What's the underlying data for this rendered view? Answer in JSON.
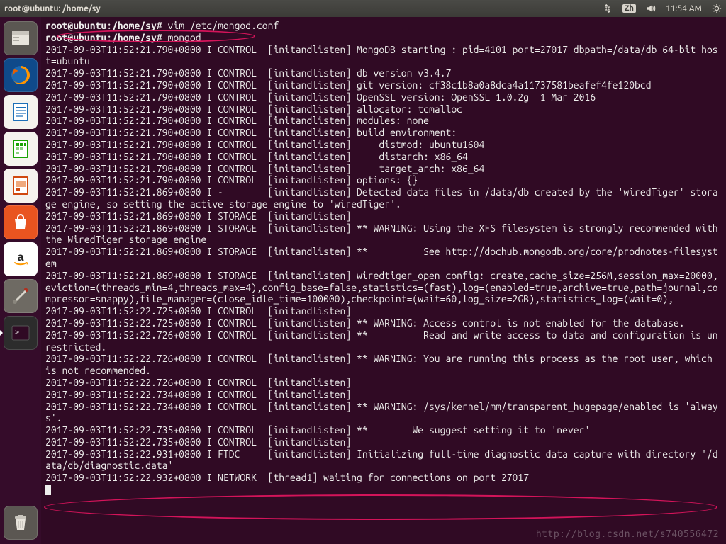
{
  "topbar": {
    "title": "root@ubuntu: /home/sy",
    "ime": "Zh",
    "time": "11:54 AM"
  },
  "launcher": {
    "items": [
      {
        "name": "files-icon",
        "bg": "#5b5752"
      },
      {
        "name": "firefox-icon",
        "bg": "#1b68b0"
      },
      {
        "name": "writer-icon",
        "bg": "#0f6eb6"
      },
      {
        "name": "calc-icon",
        "bg": "#18a303"
      },
      {
        "name": "impress-icon",
        "bg": "#d0480f"
      },
      {
        "name": "software-center-icon",
        "bg": "#e95420"
      },
      {
        "name": "amazon-icon",
        "bg": "#ffffff"
      },
      {
        "name": "settings-icon",
        "bg": "#6e6a63"
      },
      {
        "name": "terminal-icon",
        "bg": "#2c2c2c",
        "active": true
      }
    ],
    "trash": {
      "name": "trash-icon",
      "bg": "#5b5752"
    }
  },
  "terminal": {
    "prompt1_a": "root@ubuntu",
    "prompt1_b": ":",
    "prompt1_c": "/home/sy",
    "prompt1_d": "# ",
    "cmd1": "vim /etc/mongod.conf",
    "cmd2": "mongod",
    "lines": [
      "2017-09-03T11:52:21.790+0800 I CONTROL  [initandlisten] MongoDB starting : pid=4101 port=27017 dbpath=/data/db 64-bit host=ubuntu",
      "2017-09-03T11:52:21.790+0800 I CONTROL  [initandlisten] db version v3.4.7",
      "2017-09-03T11:52:21.790+0800 I CONTROL  [initandlisten] git version: cf38c1b8a0a8dca4a11737581beafef4fe120bcd",
      "2017-09-03T11:52:21.790+0800 I CONTROL  [initandlisten] OpenSSL version: OpenSSL 1.0.2g  1 Mar 2016",
      "2017-09-03T11:52:21.790+0800 I CONTROL  [initandlisten] allocator: tcmalloc",
      "2017-09-03T11:52:21.790+0800 I CONTROL  [initandlisten] modules: none",
      "2017-09-03T11:52:21.790+0800 I CONTROL  [initandlisten] build environment:",
      "2017-09-03T11:52:21.790+0800 I CONTROL  [initandlisten]     distmod: ubuntu1604",
      "2017-09-03T11:52:21.790+0800 I CONTROL  [initandlisten]     distarch: x86_64",
      "2017-09-03T11:52:21.790+0800 I CONTROL  [initandlisten]     target_arch: x86_64",
      "2017-09-03T11:52:21.790+0800 I CONTROL  [initandlisten] options: {}",
      "2017-09-03T11:52:21.869+0800 I -        [initandlisten] Detected data files in /data/db created by the 'wiredTiger' storage engine, so setting the active storage engine to 'wiredTiger'.",
      "2017-09-03T11:52:21.869+0800 I STORAGE  [initandlisten] ",
      "2017-09-03T11:52:21.869+0800 I STORAGE  [initandlisten] ** WARNING: Using the XFS filesystem is strongly recommended with the WiredTiger storage engine",
      "2017-09-03T11:52:21.869+0800 I STORAGE  [initandlisten] **          See http://dochub.mongodb.org/core/prodnotes-filesystem",
      "2017-09-03T11:52:21.869+0800 I STORAGE  [initandlisten] wiredtiger_open config: create,cache_size=256M,session_max=20000,eviction=(threads_min=4,threads_max=4),config_base=false,statistics=(fast),log=(enabled=true,archive=true,path=journal,compressor=snappy),file_manager=(close_idle_time=100000),checkpoint=(wait=60,log_size=2GB),statistics_log=(wait=0),",
      "2017-09-03T11:52:22.725+0800 I CONTROL  [initandlisten] ",
      "2017-09-03T11:52:22.725+0800 I CONTROL  [initandlisten] ** WARNING: Access control is not enabled for the database.",
      "2017-09-03T11:52:22.726+0800 I CONTROL  [initandlisten] **          Read and write access to data and configuration is unrestricted.",
      "2017-09-03T11:52:22.726+0800 I CONTROL  [initandlisten] ** WARNING: You are running this process as the root user, which is not recommended.",
      "2017-09-03T11:52:22.726+0800 I CONTROL  [initandlisten] ",
      "2017-09-03T11:52:22.734+0800 I CONTROL  [initandlisten] ",
      "2017-09-03T11:52:22.734+0800 I CONTROL  [initandlisten] ** WARNING: /sys/kernel/mm/transparent_hugepage/enabled is 'always'.",
      "2017-09-03T11:52:22.735+0800 I CONTROL  [initandlisten] **        We suggest setting it to 'never'",
      "2017-09-03T11:52:22.735+0800 I CONTROL  [initandlisten] ",
      "2017-09-03T11:52:22.931+0800 I FTDC     [initandlisten] Initializing full-time diagnostic data capture with directory '/data/db/diagnostic.data'",
      "2017-09-03T11:52:22.932+0800 I NETWORK  [thread1] waiting for connections on port 27017"
    ]
  },
  "watermark": "http://blog.csdn.net/s740556472"
}
